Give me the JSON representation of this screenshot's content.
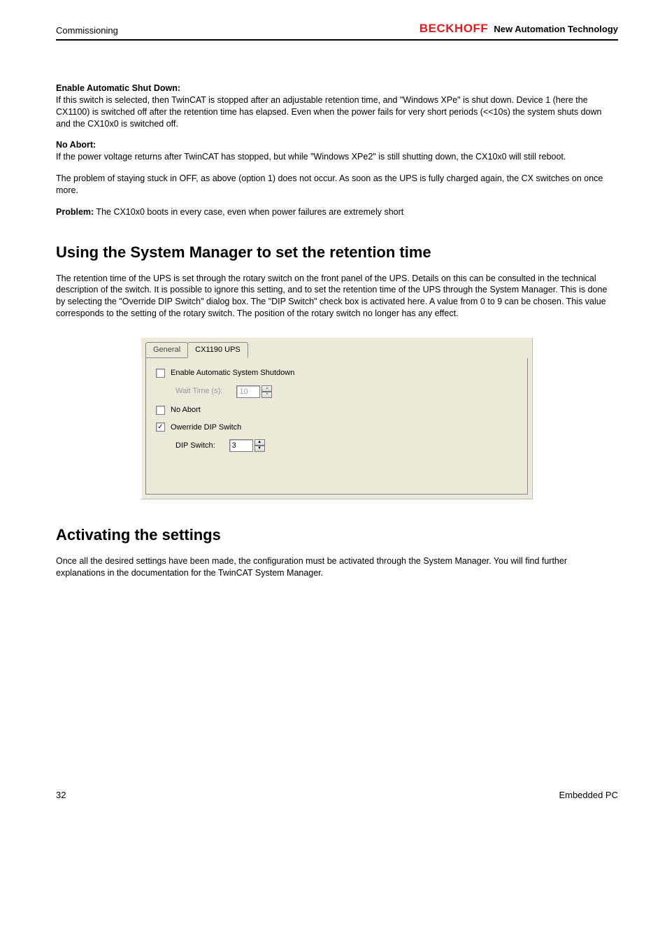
{
  "header": {
    "section": "Commissioning",
    "brand": "BECKHOFF",
    "tagline": "New Automation Technology"
  },
  "block1": {
    "title": "Enable Automatic Shut Down:",
    "text": "If this switch is selected, then TwinCAT is stopped after an adjustable retention time, and \"Windows XPe\" is shut down. Device 1 (here the CX1100) is switched off after the retention time has elapsed. Even when the power fails for very short periods (<<10s) the system shuts down and the CX10x0 is switched off."
  },
  "block2": {
    "title": "No Abort:",
    "text": "If the power voltage returns after TwinCAT has stopped, but while \"Windows XPe2\" is still shutting down, the CX10x0 will still reboot."
  },
  "para3": "The problem of staying stuck in OFF, as above (option 1) does not occur. As soon as the UPS is fully charged again, the CX switches on once more.",
  "problem": {
    "title": "Problem:",
    "text": " The CX10x0 boots in every case, even when power failures are extremely short"
  },
  "h2a": "Using the System Manager to set the retention time",
  "para5": "The retention time of the UPS is set through the rotary switch on the front panel of the UPS. Details on this can be consulted in the technical description of the switch. It is possible to ignore this setting, and to set the retention time of the UPS through the System Manager. This is done by selecting the \"Override DIP Switch\" dialog box. The \"DIP Switch\" check box is activated here. A value from 0 to 9 can be chosen. This value corresponds to the setting of the rotary switch. The position of the rotary switch no longer has any effect.",
  "dialog": {
    "tabs": {
      "general": "General",
      "active": "CX1190 UPS"
    },
    "enable": "Enable Automatic System Shutdown",
    "wait_label": "Wait Time (s):",
    "wait_value": "10",
    "no_abort": "No Abort",
    "override": "Owerride DIP Switch",
    "dip_label": "DIP Switch:",
    "dip_value": "3",
    "check_glyph": "✓"
  },
  "h2b": "Activating the settings",
  "para6": "Once all the desired settings have been made, the configuration must be activated through the System Manager. You will find further explanations in the documentation for the TwinCAT System Manager.",
  "footer": {
    "page": "32",
    "doc": "Embedded PC"
  }
}
